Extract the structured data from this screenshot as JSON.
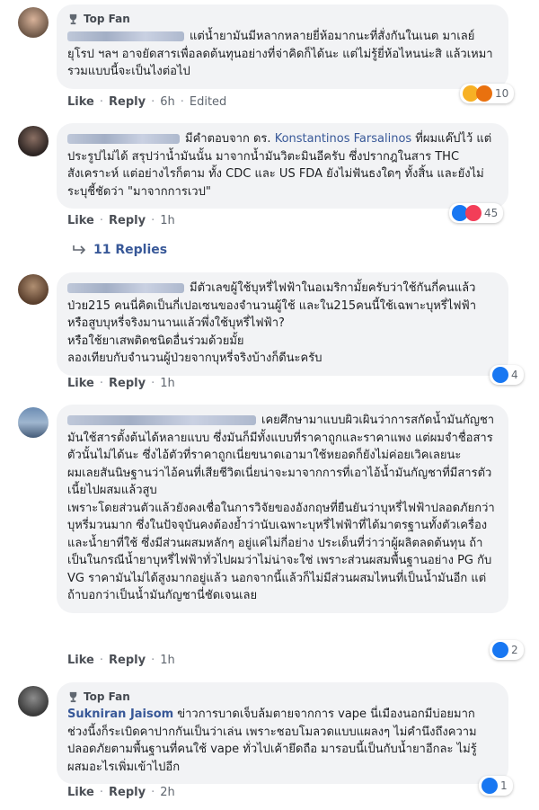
{
  "comments": [
    {
      "top_fan": "Top Fan",
      "name": "",
      "text": "แต่น้ำยามันมีหลากหลายยี่ห้อมากนะที่สั่งกันในเนต มาเลย์ ยุโรป ฯลฯ อาจยัดสารเพื่อลดต้นทุนอย่างที่จ่าคิดก็ได้นะ แต่ไม่รู้ยี่ห้อไหนน่ะสิ แล้วเหมารวมแบบนี้จะเป็นไงต่อไป",
      "like": "Like",
      "reply": "Reply",
      "time": "6h",
      "edited": "Edited",
      "reaction_count": "10",
      "reaction_icons": [
        "haha-icon",
        "angry-icon"
      ]
    },
    {
      "name": "",
      "text_before": "มีคำตอบจาก ดร. ",
      "link": "Konstantinos Farsalinos",
      "text_after": " ที่ผมแค๊ปไว้ แต่ประรูปไม่ได้ สรุปว่าน้ำมันนั้น มาจากน้ำมันวิตะมินอีครับ ซึ่งปรากฎในสาร THC สังเคราะห์ แต่อย่างไรก็ตาม ทั้ง CDC และ US FDA ยังไม่ฟันธงใดๆ ทั้งสิ้น และยังไม่ระบุชี้ชัดว่า \"มาจากการเวป\"",
      "like": "Like",
      "reply": "Reply",
      "time": "1h",
      "reaction_count": "45",
      "reaction_icons": [
        "like-icon",
        "love-icon"
      ],
      "replies_label": "11 Replies"
    },
    {
      "name": "",
      "text": "มีตัวเลขผู้ใช้บุหรี่ไฟฟ้าในอเมริกามั้ยครับว่าใช้กันกี่คนแล้ว ป่วย215 คนนี่คิดเป็นกี่เปอเซนของจำนวนผู้ใช้ และใน215คนนี้ใช้เฉพาะบุหรี่ไฟฟ้า หรือสูบบุหรี่จริงมานานแล้วพึ่งใช้บุหรี่ไฟฟ้า?\nหรือใช้ยาเสพติดชนิดอื่นร่วมด้วยมั้ย\nลองเทียบกับจำนวนผู้ป่วยจากบุหรี่จริงบ้างก็ดีนะครับ",
      "like": "Like",
      "reply": "Reply",
      "time": "1h",
      "reaction_count": "4",
      "reaction_icons": [
        "like-icon"
      ]
    },
    {
      "name": "",
      "text": "เคยศึกษามาแบบผิวเผินว่าการสกัดน้ำมันกัญชามันใช้สารตั้งต้นได้หลายแบบ ซึ่งมันก็มีทั้งแบบที่ราคาถูกและราคาแพง แต่ผมจำชื่อสารตัวนั้นไม่ได้นะ ซึ่งไอ้ตัวที่ราคาถูกเนี่ยขนาดเอามาใช้หยอดก็ยังไม่ค่อยเวิคเลยนะ\nผมเลยสันนิษฐานว่าไอ้คนที่เสียชีวิตเนี่ยน่าจะมาจากการที่เอาไอ้น้ำมันกัญชาที่มีสารตัวเนี้ยไปผสมแล้วสูบ\nเพราะโดยส่วนตัวแล้วยังคงเชื่อในการวิจัยของอังกฤษที่ยืนยันว่าบุหรี่ไฟฟ้าปลอดภัยกว่าบุหรี่มวนมาก ซึ่งในปัจจุบันคงต้องย้ำว่านับเฉพาะบุหรี่ไฟฟ้าที่ได้มาตรฐานทั้งตัวเครื่องและน้ำยาที่ใช้ ซึ่งมีส่วนผสมหลักๆ อยู่แค่ไม่กี่อย่าง ประเด็นที่ว่าว่าผู้ผลิตลดต้นทุน ถ้าเป็นในกรณีน้ำยาบุหรี่ไฟฟ้าทั่วไปผมว่าไม่น่าจะใช่ เพราะส่วนผสมพื้นฐานอย่าง PG กับ VG ราคามันไม่ได้สูงมากอยู่แล้ว นอกจากนี้แล้วก็ไม่มีส่วนผสมไหนที่เป็นน้ำมันอีก แต่ถ้าบอกว่าเป็นน้ำมันกัญชานี่ชัดเจนเลย",
      "like": "Like",
      "reply": "Reply",
      "time": "1h",
      "reaction_count": "2",
      "reaction_icons": [
        "like-icon"
      ]
    },
    {
      "top_fan": "Top Fan",
      "name": "Sukniran Jaisom",
      "text": "ข่าวการบาดเจ็บล้มตายจากการ vape นี่เมืองนอกมีบ่อยมาก ช่วงนี้งก็ระเบิดคาปากกันเป็นว่าเล่น เพราะชอบโมลวดแบบแผลงๆ ไม่คำนึงถึงความปลอดภัยตามพื้นฐานที่คนใช้ vape ทั่วไปเค้ายึดถือ มารอบนี้เป็นกับน้ำยาอีกละ ไม่รู้ผสมอะไรเพิ่มเข้าไปอีก",
      "like": "Like",
      "reply": "Reply",
      "time": "2h",
      "reaction_count": "1",
      "reaction_icons": [
        "like-icon"
      ]
    }
  ],
  "colors": {
    "link": "#385898",
    "bubble": "#f2f3f5",
    "like": "#1877f2",
    "love": "#f33e58",
    "haha": "#f7b125",
    "angry": "#e9710f"
  }
}
